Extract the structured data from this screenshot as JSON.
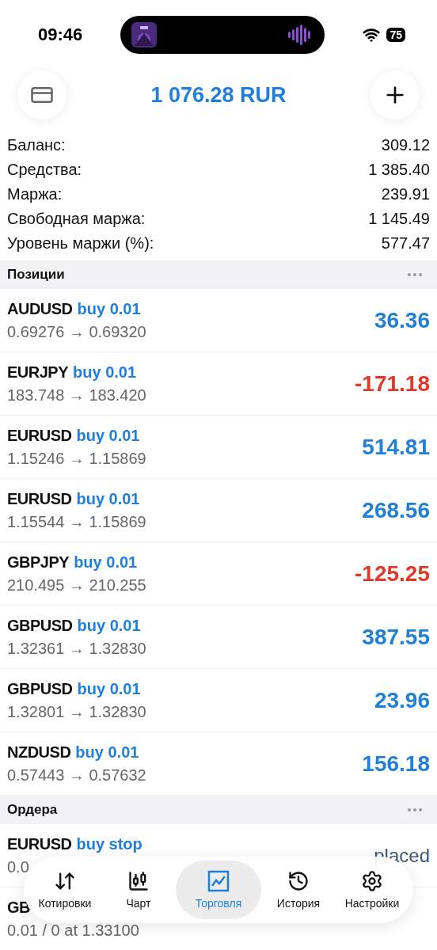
{
  "status_bar": {
    "time": "09:46",
    "battery": "75"
  },
  "header": {
    "title": "1 076.28 RUR"
  },
  "summary": [
    {
      "label": "Баланс:",
      "value": "309.12"
    },
    {
      "label": "Средства:",
      "value": "1 385.40"
    },
    {
      "label": "Маржа:",
      "value": "239.91"
    },
    {
      "label": "Свободная маржа:",
      "value": "1 145.49"
    },
    {
      "label": "Уровень маржи (%):",
      "value": "577.47"
    }
  ],
  "positions": {
    "title": "Позиции",
    "items": [
      {
        "symbol": "AUDUSD",
        "type": "buy 0.01",
        "prices": "0.69276 → 0.69320",
        "profit": "36.36",
        "kind": "gain"
      },
      {
        "symbol": "EURJPY",
        "type": "buy 0.01",
        "prices": "183.748 → 183.420",
        "profit": "-171.18",
        "kind": "loss"
      },
      {
        "symbol": "EURUSD",
        "type": "buy 0.01",
        "prices": "1.15246 → 1.15869",
        "profit": "514.81",
        "kind": "gain"
      },
      {
        "symbol": "EURUSD",
        "type": "buy 0.01",
        "prices": "1.15544 → 1.15869",
        "profit": "268.56",
        "kind": "gain"
      },
      {
        "symbol": "GBPJPY",
        "type": "buy 0.01",
        "prices": "210.495 → 210.255",
        "profit": "-125.25",
        "kind": "loss"
      },
      {
        "symbol": "GBPUSD",
        "type": "buy 0.01",
        "prices": "1.32361 → 1.32830",
        "profit": "387.55",
        "kind": "gain"
      },
      {
        "symbol": "GBPUSD",
        "type": "buy 0.01",
        "prices": "1.32801 → 1.32830",
        "profit": "23.96",
        "kind": "gain"
      },
      {
        "symbol": "NZDUSD",
        "type": "buy 0.01",
        "prices": "0.57443 → 0.57632",
        "profit": "156.18",
        "kind": "gain"
      }
    ]
  },
  "orders": {
    "title": "Ордера",
    "items": [
      {
        "symbol": "EURUSD",
        "type": "buy stop",
        "detail": "0.0",
        "status": "placed"
      },
      {
        "symbol": "GB",
        "detail": "0.01 / 0 at 1.33100"
      }
    ]
  },
  "tab_bar": [
    {
      "label": "Котировки",
      "selected": false
    },
    {
      "label": "Чарт",
      "selected": false
    },
    {
      "label": "Торговля",
      "selected": true
    },
    {
      "label": "История",
      "selected": false
    },
    {
      "label": "Настройки",
      "selected": false
    }
  ]
}
